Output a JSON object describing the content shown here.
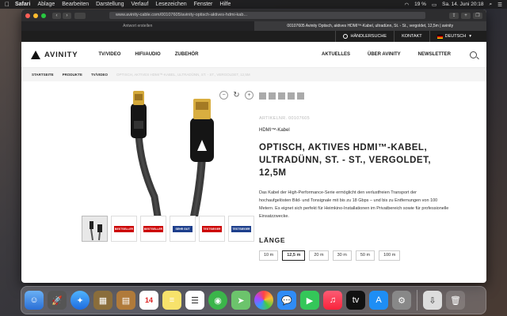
{
  "menubar": {
    "app": "Safari",
    "items": [
      "Ablage",
      "Bearbeiten",
      "Darstellung",
      "Verlauf",
      "Lesezeichen",
      "Fenster",
      "Hilfe"
    ],
    "battery": "19 %",
    "datetime": "Sa. 14. Juni 20:18"
  },
  "browser": {
    "url": "www.avinity-cable.com/00107605/avinity-optisch-aktives-hdmi-kab...",
    "tabs": [
      {
        "label": "Antwort erstellen"
      },
      {
        "label": "00107605 Avinity Optisch, aktives HDMI™-Kabel, ultradünn, St. - St., vergoldet, 12,5m | avinity"
      }
    ]
  },
  "topstrip": {
    "dealer": "HÄNDLERSUCHE",
    "contact": "KONTAKT",
    "language": "DEUTSCH"
  },
  "header": {
    "logo": "AVINITY",
    "nav": [
      "TV/VIDEO",
      "HIFI/AUDIO",
      "ZUBEHÖR"
    ],
    "right": [
      "AKTUELLES",
      "ÜBER AVINITY",
      "NEWSLETTER"
    ]
  },
  "breadcrumb": {
    "items": [
      "STARTSEITE",
      "PRODUKTE",
      "TV/VIDEO"
    ],
    "current": "OPTISCH, AKTIVES HDMI™-KABEL, ULTRADÜNN, ST. - ST., VERGOLDET, 12,5M"
  },
  "product": {
    "artnr": "ARTIKELNR. 00107605",
    "category": "HDMI™-Kabel",
    "title": "OPTISCH, AKTIVES HDMI™-KABEL, ULTRADÜNN, ST. - ST., VERGOLDET, 12,5M",
    "description": "Das Kabel der High-Performance-Serie ermöglicht den verlustfreien Transport der hochaufgelösten Bild- und Tonsignale mit bis zu 18 Gbps – und bis zu Entfernungen von 100 Metern. Es eignet sich perfekt für Heimkino-Installationen im Privatbereich sowie für professionelle Einsatzzwecke.",
    "length_label": "LÄNGE",
    "lengths": [
      "10 m",
      "12,5 m",
      "20 m",
      "30 m",
      "50 m",
      "100 m"
    ],
    "selected_length": "12,5 m",
    "thumb_badges": [
      "",
      "BESTSELLER",
      "BESTSELLER",
      "SEHR GUT",
      "TESTSIEGER",
      "TESTSIEGER"
    ]
  },
  "colors": {
    "accent": "#222222",
    "topstrip_bg": "#1e1e1e"
  }
}
